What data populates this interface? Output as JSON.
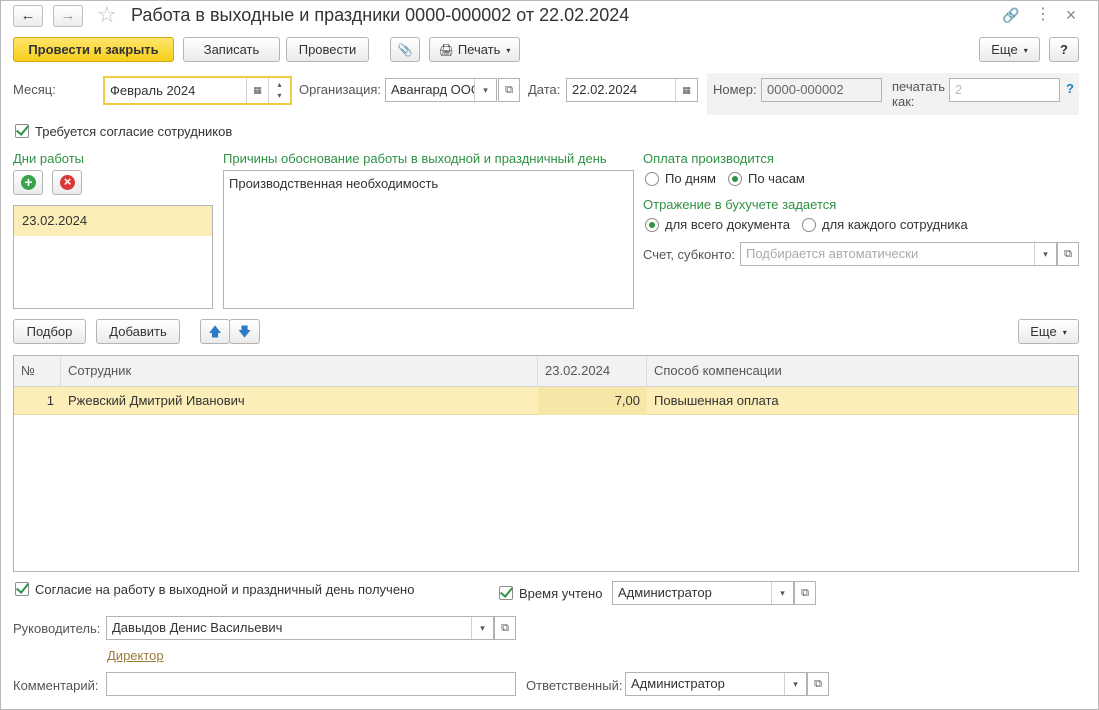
{
  "window": {
    "title": "Работа в выходные и праздники 0000-000002 от 22.02.2024",
    "back_icon": "←",
    "forward_icon": "→",
    "star_icon": "☆",
    "link_icon": "🔗",
    "menu_icon": "⋮",
    "close_icon": "×"
  },
  "toolbar": {
    "post_close": "Провести и закрыть",
    "save": "Записать",
    "post": "Провести",
    "attach_icon": "📎",
    "print": "Печать",
    "print_icon": "🖨",
    "more": "Еще",
    "help": "?"
  },
  "header": {
    "month_label": "Месяц:",
    "month_value": "Февраль 2024",
    "org_label": "Организация:",
    "org_value": "Авангард ООО",
    "date_label": "Дата:",
    "date_value": "22.02.2024",
    "number_label": "Номер:",
    "number_value": "0000-000002",
    "print_as_label_1": "печатать",
    "print_as_label_2": "как:",
    "print_as_value": "2",
    "help_q": "?"
  },
  "consent_required": "Требуется согласие сотрудников",
  "work_days": {
    "label": "Дни работы",
    "add_icon": "+",
    "remove_icon": "×",
    "items": [
      "23.02.2024"
    ]
  },
  "reasons": {
    "label": "Причины обоснование работы в выходной и праздничный день",
    "text": "Производственная необходимость"
  },
  "payment": {
    "label": "Оплата производится",
    "by_days": "По дням",
    "by_hours": "По часам"
  },
  "accounting": {
    "label": "Отражение в бухучете задается",
    "whole_doc": "для всего документа",
    "each_employee": "для каждого сотрудника",
    "account_label": "Счет, субконто:",
    "account_placeholder": "Подбирается автоматически"
  },
  "table_toolbar": {
    "pick": "Подбор",
    "add": "Добавить",
    "up_icon": "🡅",
    "down_icon": "🡇",
    "more": "Еще"
  },
  "table": {
    "columns": [
      "№",
      "Сотрудник",
      "23.02.2024",
      "Способ компенсации"
    ],
    "rows": [
      {
        "n": "1",
        "employee": "Ржевский Дмитрий Иванович",
        "hours": "7,00",
        "compensation": "Повышенная оплата"
      }
    ]
  },
  "footer": {
    "consent_received": "Согласие на работу в выходной и праздничный день получено",
    "time_counted": "Время учтено",
    "time_counted_by": "Администратор",
    "head_label": "Руководитель:",
    "head_value": "Давыдов Денис Васильевич",
    "head_position": "Директор",
    "comment_label": "Комментарий:",
    "comment_value": "",
    "responsible_label": "Ответственный:",
    "responsible_value": "Администратор"
  },
  "glyphs": {
    "dropdown": "▾",
    "open": "⧉",
    "calendar": "▦",
    "spin_up": "▴",
    "spin_down": "▾"
  }
}
